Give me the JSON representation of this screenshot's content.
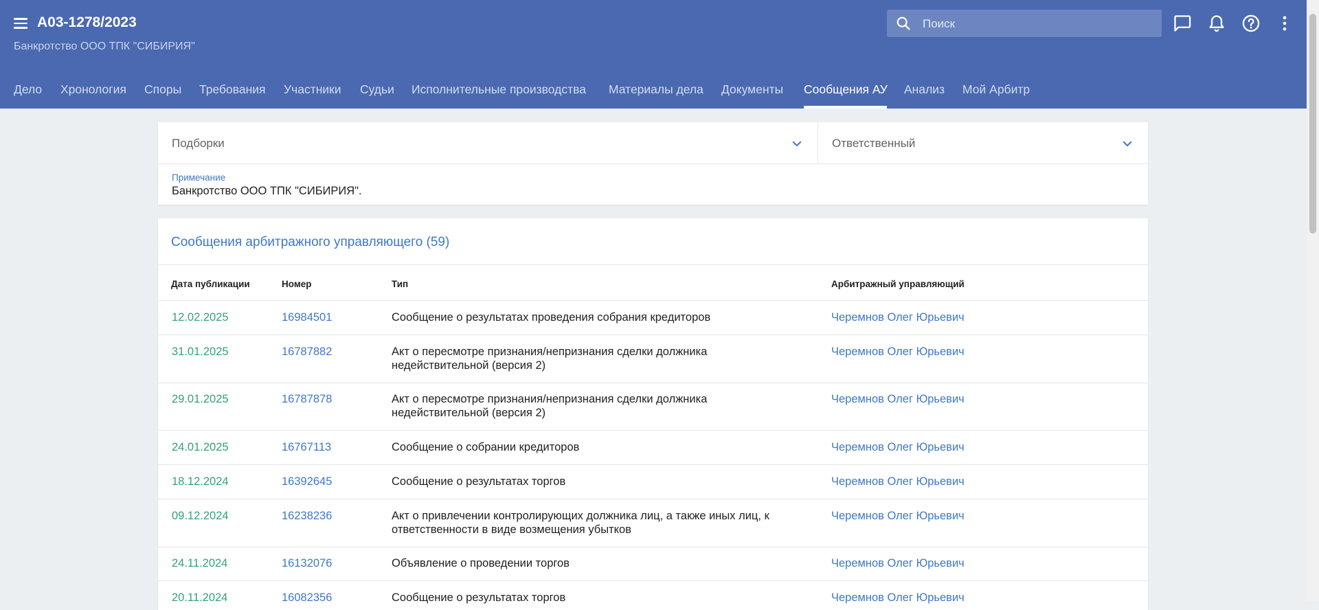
{
  "header": {
    "case_number": "А03-1278/2023",
    "subtitle": "Банкротство ООО ТПК \"СИБИРИЯ\"",
    "search_placeholder": "Поиск"
  },
  "tabs": [
    {
      "label": "Дело"
    },
    {
      "label": "Хронология"
    },
    {
      "label": "Споры"
    },
    {
      "label": "Требования"
    },
    {
      "label": "Участники"
    },
    {
      "label": "Судьи"
    },
    {
      "label": "Исполнительные производства"
    },
    {
      "label": "Материалы дела"
    },
    {
      "label": "Документы"
    },
    {
      "label": "Сообщения АУ",
      "active": true
    },
    {
      "label": "Анализ"
    },
    {
      "label": "Мой Арбитр"
    }
  ],
  "filters": {
    "collections_label": "Подборки",
    "responsible_label": "Ответственный",
    "note_label": "Примечание",
    "note_text": "Банкротство ООО ТПК \"СИБИРИЯ\"."
  },
  "messages": {
    "title": "Сообщения арбитражного управляющего (59)",
    "columns": {
      "date": "Дата публикации",
      "number": "Номер",
      "type": "Тип",
      "manager": "Арбитражный управляющий"
    },
    "rows": [
      {
        "date": "12.02.2025",
        "number": "16984501",
        "type": [
          "Сообщение о результатах проведения собрания кредиторов"
        ],
        "manager": "Черемнов Олег Юрьевич"
      },
      {
        "date": "31.01.2025",
        "number": "16787882",
        "type": [
          "Акт о пересмотре признания/непризнания сделки должника",
          "недействительной (версия 2)"
        ],
        "manager": "Черемнов Олег Юрьевич"
      },
      {
        "date": "29.01.2025",
        "number": "16787878",
        "type": [
          "Акт о пересмотре признания/непризнания сделки должника",
          "недействительной (версия 2)"
        ],
        "manager": "Черемнов Олег Юрьевич"
      },
      {
        "date": "24.01.2025",
        "number": "16767113",
        "type": [
          "Сообщение о собрании кредиторов"
        ],
        "manager": "Черемнов Олег Юрьевич"
      },
      {
        "date": "18.12.2024",
        "number": "16392645",
        "type": [
          "Сообщение о результатах торгов"
        ],
        "manager": "Черемнов Олег Юрьевич"
      },
      {
        "date": "09.12.2024",
        "number": "16238236",
        "type": [
          "Акт о привлечении контролирующих должника лиц, а также иных лиц, к",
          "ответственности в виде возмещения убытков"
        ],
        "manager": "Черемнов Олег Юрьевич"
      },
      {
        "date": "24.11.2024",
        "number": "16132076",
        "type": [
          "Объявление о проведении торгов"
        ],
        "manager": "Черемнов Олег Юрьевич"
      },
      {
        "date": "20.11.2024",
        "number": "16082356",
        "type": [
          "Сообщение о результатах торгов"
        ],
        "manager": "Черемнов Олег Юрьевич"
      }
    ]
  },
  "colors": {
    "header_bg": "#4a69b0",
    "link": "#3e78c8",
    "date": "#34a07c",
    "page_bg": "#eceff1"
  },
  "icons": [
    "menu-icon",
    "search-icon",
    "chat-icon",
    "bell-icon",
    "help-icon",
    "more-vert-icon",
    "chevron-down-icon"
  ]
}
